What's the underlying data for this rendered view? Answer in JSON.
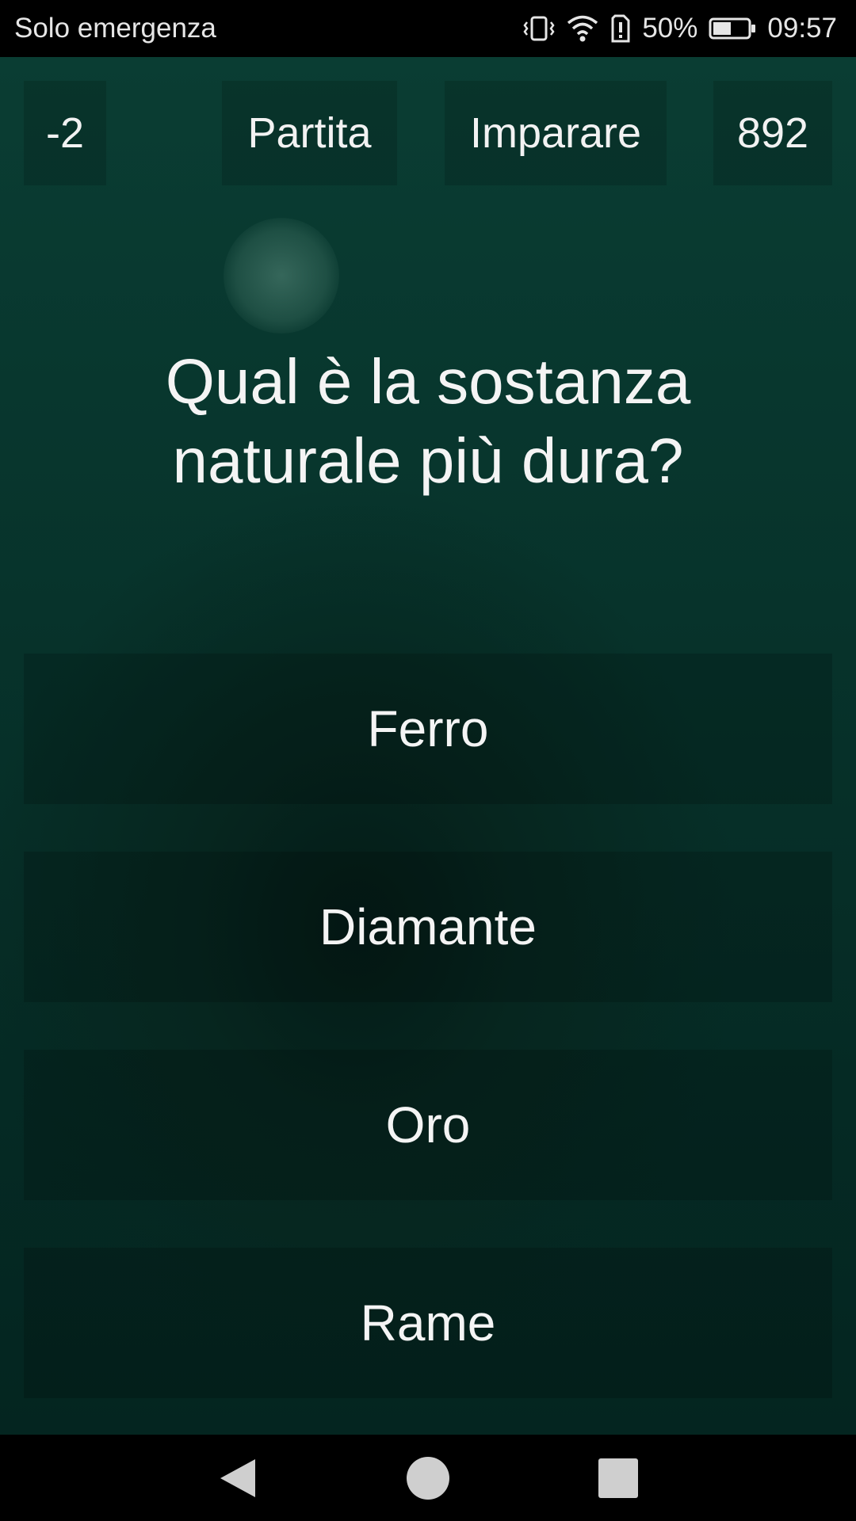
{
  "status_bar": {
    "carrier": "Solo emergenza",
    "battery_percent": "50%",
    "time": "09:57",
    "icons": [
      "vibrate-icon",
      "wifi-icon",
      "alert-icon",
      "battery-icon"
    ]
  },
  "header": {
    "score": "-2",
    "partita_label": "Partita",
    "imparare_label": "Imparare",
    "points": "892"
  },
  "question": {
    "line1": "Qual è la sostanza",
    "line2": "naturale più dura?"
  },
  "answers": [
    {
      "label": "Ferro"
    },
    {
      "label": "Diamante"
    },
    {
      "label": "Oro"
    },
    {
      "label": "Rame"
    }
  ],
  "nav": {
    "icons": [
      "back-icon",
      "home-icon",
      "recents-icon"
    ]
  },
  "colors": {
    "background_top": "#0a3d33",
    "background_bottom": "#042520",
    "text": "#f4f4f4"
  }
}
